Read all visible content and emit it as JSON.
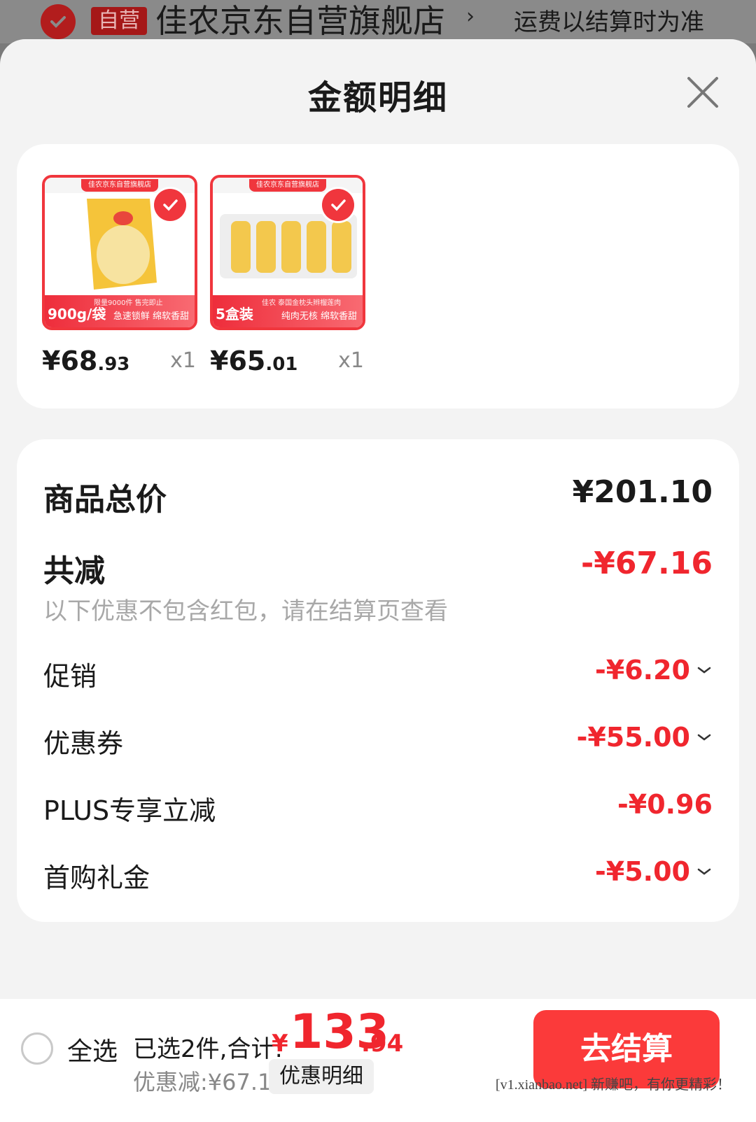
{
  "store": {
    "badge": "自营",
    "name": "佳农京东自营旗舰店",
    "arrow": "›",
    "shipping_note": "运费以结算时为准"
  },
  "sheet": {
    "title": "金额明细"
  },
  "products": [
    {
      "thumb_top": "佳农京东自营旗舰店",
      "band_big": "900g/袋",
      "band_sub": "急速锁鲜 绵软香甜",
      "band_tag": "限量9000件 售完即止",
      "price_main": "¥68",
      "price_cents": ".93",
      "qty": "x1",
      "accent": "#f5c43a"
    },
    {
      "thumb_top": "佳农京东自营旗舰店",
      "band_big": "5盒装",
      "band_sub": "纯肉无核 绵软香甜",
      "band_tag": "佳农 泰国金枕头辫榴莲肉",
      "price_main": "¥65",
      "price_cents": ".01",
      "qty": "x1",
      "accent": "#f3c84d"
    }
  ],
  "summary": {
    "total_label": "商品总价",
    "total_value": "¥201.10",
    "reduce_label": "共减",
    "reduce_value": "-¥67.16",
    "note": "以下优惠不包含红包，请在结算页查看",
    "items": [
      {
        "label": "促销",
        "value": "-¥6.20",
        "expandable": true
      },
      {
        "label": "优惠券",
        "value": "-¥55.00",
        "expandable": true
      },
      {
        "label": "PLUS专享立减",
        "value": "-¥0.96",
        "expandable": false
      },
      {
        "label": "首购礼金",
        "value": "-¥5.00",
        "expandable": true
      }
    ]
  },
  "bottom": {
    "select_all": "全选",
    "selected_text": "已选2件,合计:",
    "total_yen": "¥",
    "total_main": "133",
    "total_cents": ".94",
    "discount_text": "优惠减:¥67.16",
    "detail_button": "优惠明细",
    "checkout_button": "去结算",
    "watermark": "[v1.xianbao.net] 新赚吧，有你更精彩！"
  },
  "colors": {
    "accent_red": "#f0262e",
    "checkout_red": "#fb3a3a"
  }
}
